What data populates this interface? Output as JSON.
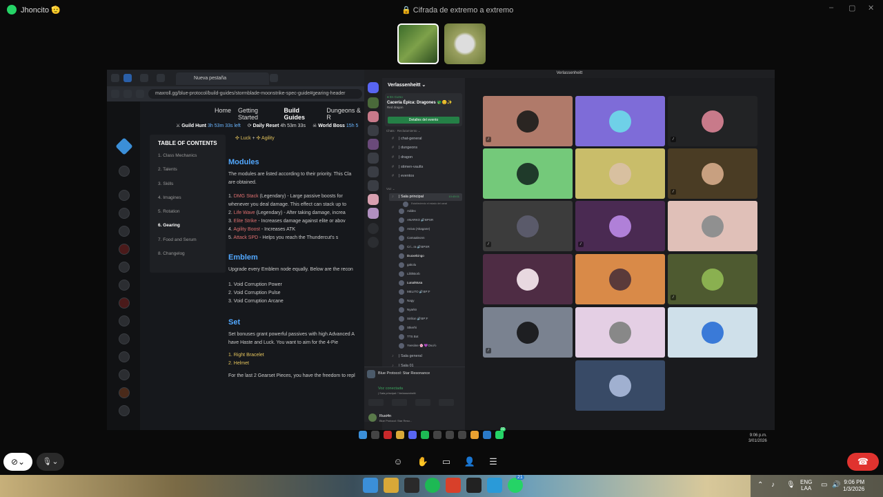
{
  "whatsapp": {
    "contact_name": "Jhoncito 🫡",
    "encryption_label": "Cifrada de extremo a extremo",
    "window_controls": [
      "–",
      "▢",
      "✕"
    ]
  },
  "browser": {
    "tab_title": "Nueva pestaña",
    "url": "maxroll.gg/blue-protocol/build-guides/stormblade-moonstrike-spec-guide#gearing-header",
    "nav": [
      "Home",
      "Getting Started",
      "Build Guides",
      "Dungeons & R"
    ],
    "timers": [
      {
        "label": "Guild Hunt",
        "value": "3h 53m 33s left"
      },
      {
        "label": "Daily Reset",
        "value": "4h 53m 33s"
      },
      {
        "label": "World Boss",
        "value": "15h 5"
      }
    ],
    "toc_title": "TABLE OF CONTENTS",
    "toc": [
      "1.  Class Mechanics",
      "2.  Talents",
      "3.  Skills",
      "4.  Imagines",
      "5.  Rotation",
      "6.  Gearing",
      "7.  Food and Serum",
      "8.  Changelog"
    ],
    "stat_line": [
      "Luck",
      "+",
      "Agility"
    ],
    "modules_heading": "Modules",
    "modules_intro": [
      "The modules are listed according to their priority. This Cla",
      "are obtained."
    ],
    "modules": [
      {
        "n": "1.",
        "name": "DMG Stack",
        "desc": "(Legendary) - Large passive boosts for"
      },
      {
        "n": "",
        "name": "",
        "desc": "whenever you deal damage. This effect can stack up to"
      },
      {
        "n": "2.",
        "name": "Life Wave",
        "desc": "(Legendary) - After taking damage, increa"
      },
      {
        "n": "3.",
        "name": "Elite Strike",
        "desc": "- Increases damage against elite or abov"
      },
      {
        "n": "4.",
        "name": "Agility Boost",
        "desc": "- Increases  ATK"
      },
      {
        "n": "5.",
        "name": "Attack SPD",
        "desc": "- Helps you reach the  Thundercut's s"
      }
    ],
    "emblem_heading": "Emblem",
    "emblem_intro": "Upgrade every Emblem node equally. Below are the recon",
    "emblems": [
      "1. Void Corruption Power",
      "2. Void Corruption Pulse",
      "3. Void Corruption Arcane"
    ],
    "set_heading": "Set",
    "set_intro": [
      "Set bonuses grant powerful passives with high Advanced A",
      "have  Haste and  Luck. You want to aim for the 4-Pie"
    ],
    "set_items": [
      "1.  Right Bracelet",
      "2.  Helmet"
    ],
    "set_outro": "For the last 2 Gearset Pieces, you have the freedom to repl"
  },
  "discord": {
    "window_title": "Verlassenheitt",
    "server_name": "Verlassenheitt ⌄",
    "event_live": "● En Curso",
    "event_title": "Cacería Épica: Dragones 🐲😊✨",
    "event_sub": "Red dragon",
    "event_button": "Detalles del evento",
    "category_text": "Chats · Reclutamiento ⌄",
    "channels": [
      "| chat-general",
      "| dungeons",
      "| dragon",
      "| stimen-vaults",
      "| eventos"
    ],
    "category_voice": "Voz ⌄",
    "active_voice": "| Sala principal",
    "active_voice_time": "10:45:01",
    "active_voice_sub": "Estableciendo el estado del canal",
    "members": [
      "Addex",
      "ANARKO  🔊BPSR",
      "Aniva (Akagane)",
      "Camaaleonn",
      "Cri...ra  🔊BPSR",
      "Duoxelcingo",
      "gakolu",
      "LilithBorb",
      "Luna/Musa",
      "MELITO  🔊BP:F",
      "Nagy",
      "Nyarkn",
      "Sirilion  🔊BP:F",
      "Stkerhi",
      "TTS Bot",
      "Yvesiine 🌸 💜Ovu½"
    ],
    "channels_bottom": [
      "| Sala general",
      "| Sala 01"
    ],
    "activity": "Blue Protocol: Star Resonance",
    "voice_status": "Voz conectada",
    "voice_sub": "| Sala principal / Verlassenheitt",
    "user_name": "Rusi4n",
    "user_game": "Blue Protocol: Star Reso..."
  },
  "tiles": [
    {
      "bg": "#b07a6a",
      "av": "#2a2522",
      "mic": true
    },
    {
      "bg": "#7e6cd8",
      "av": "#6fd0e8",
      "mic": false
    },
    {
      "bg": "#222325",
      "av": "#c87a8a",
      "mic": true
    },
    {
      "bg": "#74c97a",
      "av": "#1f3a2a",
      "mic": false
    },
    {
      "bg": "#c9bd6a",
      "av": "#d8c0a0",
      "mic": false
    },
    {
      "bg": "#4a3c24",
      "av": "#c8a080",
      "mic": true
    },
    {
      "bg": "#3c3c3c",
      "av": "#5a5a6a",
      "mic": true
    },
    {
      "bg": "#4a2a52",
      "av": "#b080d8",
      "mic": true
    },
    {
      "bg": "#e0c0b8",
      "av": "#909090",
      "mic": false
    },
    {
      "bg": "#4e2c44",
      "av": "#e8d8e0",
      "mic": false
    },
    {
      "bg": "#d98a48",
      "av": "#5a3a3a",
      "mic": false
    },
    {
      "bg": "#4e5a30",
      "av": "#8ab050",
      "mic": true
    },
    {
      "bg": "#7a8290",
      "av": "#1e1f22",
      "mic": true
    },
    {
      "bg": "#e4cfe4",
      "av": "#888",
      "mic": false
    },
    {
      "bg": "#cfe0ea",
      "av": "#3a7ad8",
      "mic": false
    },
    {
      "bg": "#384a66",
      "av": "#a0b0d0",
      "mic": false
    }
  ],
  "inner_clock": [
    "9:06 p.m.",
    "3/01/2026"
  ],
  "taskbar_clock": [
    "9:06 PM",
    "1/3/2026"
  ],
  "taskbar_lang": [
    "ENG",
    "LAA"
  ],
  "taskbar_badge": "21",
  "inner_badge": "33",
  "colors": {
    "accent": "#52a8ff",
    "discord_green": "#248046",
    "hangup": "#e0332f",
    "whatsapp": "#25d366"
  }
}
